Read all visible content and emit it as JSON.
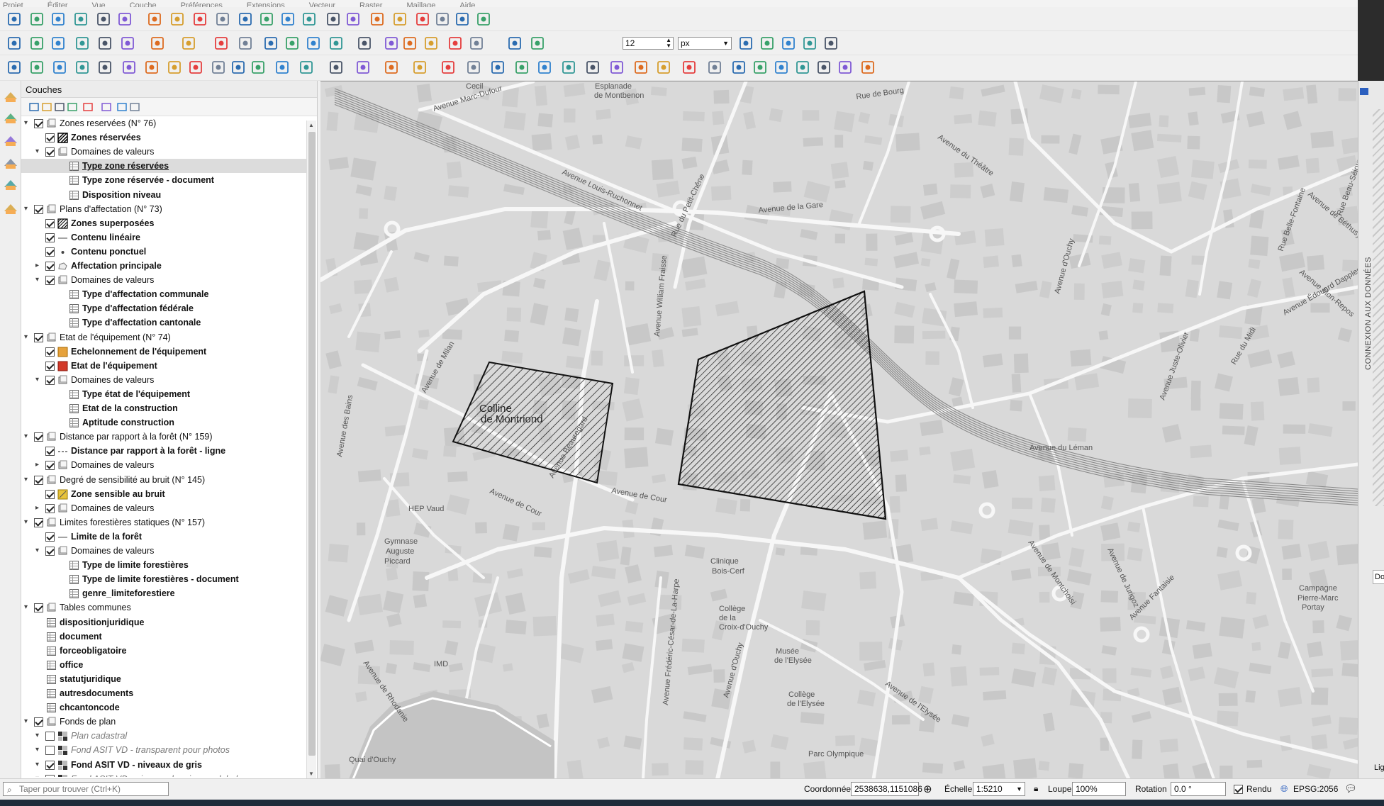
{
  "menu": [
    "Projet",
    "Éditer",
    "Vue",
    "Couche",
    "Préférences",
    "Extensions",
    "Vecteur",
    "Raster",
    "Maillage",
    "Aide"
  ],
  "toolbar": {
    "snap_tolerance": "12",
    "snap_unit": "px"
  },
  "layers_panel": {
    "title": "Couches",
    "tree": [
      {
        "label": "Zones reservées (N° 76)",
        "indent": 0,
        "arrow": "down",
        "checked": true,
        "icon": "group",
        "style": "normal"
      },
      {
        "label": "Zones réservées",
        "indent": 1,
        "arrow": "",
        "checked": true,
        "icon": "hatch",
        "style": "bold"
      },
      {
        "label": "Domaines de valeurs",
        "indent": 1,
        "arrow": "down",
        "checked": true,
        "icon": "group",
        "style": "normal"
      },
      {
        "label": "Type zone réservées",
        "indent": 2,
        "arrow": "",
        "checked": null,
        "icon": "table",
        "style": "bold-underline",
        "selected": true
      },
      {
        "label": "Type zone réservée - document",
        "indent": 2,
        "arrow": "",
        "checked": null,
        "icon": "table",
        "style": "bold"
      },
      {
        "label": "Disposition niveau",
        "indent": 2,
        "arrow": "",
        "checked": null,
        "icon": "table",
        "style": "bold"
      },
      {
        "label": "Plans d'affectation (N° 73)",
        "indent": 0,
        "arrow": "down",
        "checked": true,
        "icon": "group",
        "style": "normal"
      },
      {
        "label": "Zones superposées",
        "indent": 1,
        "arrow": "",
        "checked": true,
        "icon": "hatch2",
        "style": "bold"
      },
      {
        "label": "Contenu linéaire",
        "indent": 1,
        "arrow": "",
        "checked": true,
        "icon": "line",
        "style": "bold"
      },
      {
        "label": "Contenu ponctuel",
        "indent": 1,
        "arrow": "",
        "checked": true,
        "icon": "point",
        "style": "bold"
      },
      {
        "label": "Affectation principale",
        "indent": 1,
        "arrow": "right",
        "checked": true,
        "icon": "polygon",
        "style": "bold"
      },
      {
        "label": "Domaines de valeurs",
        "indent": 1,
        "arrow": "down",
        "checked": true,
        "icon": "group",
        "style": "normal"
      },
      {
        "label": "Type d'affectation communale",
        "indent": 2,
        "arrow": "",
        "checked": null,
        "icon": "table",
        "style": "bold"
      },
      {
        "label": "Type d'affectation fédérale",
        "indent": 2,
        "arrow": "",
        "checked": null,
        "icon": "table",
        "style": "bold"
      },
      {
        "label": "Type d'affectation cantonale",
        "indent": 2,
        "arrow": "",
        "checked": null,
        "icon": "table",
        "style": "bold"
      },
      {
        "label": "Etat de l'équipement (N° 74)",
        "indent": 0,
        "arrow": "down",
        "checked": true,
        "icon": "group",
        "style": "normal"
      },
      {
        "label": "Echelonnement de l'équipement",
        "indent": 1,
        "arrow": "",
        "checked": true,
        "icon": "fill-orange",
        "style": "bold"
      },
      {
        "label": "Etat de l'équipement",
        "indent": 1,
        "arrow": "",
        "checked": true,
        "icon": "fill-red",
        "style": "bold"
      },
      {
        "label": "Domaines de valeurs",
        "indent": 1,
        "arrow": "down",
        "checked": true,
        "icon": "group",
        "style": "normal"
      },
      {
        "label": "Type état de l'équipement",
        "indent": 2,
        "arrow": "",
        "checked": null,
        "icon": "table",
        "style": "bold"
      },
      {
        "label": "Etat de la construction",
        "indent": 2,
        "arrow": "",
        "checked": null,
        "icon": "table",
        "style": "bold"
      },
      {
        "label": "Aptitude construction",
        "indent": 2,
        "arrow": "",
        "checked": null,
        "icon": "table",
        "style": "bold"
      },
      {
        "label": "Distance par rapport à la forêt (N° 159)",
        "indent": 0,
        "arrow": "down",
        "checked": true,
        "icon": "group",
        "style": "normal"
      },
      {
        "label": "Distance par rapport à la forêt - ligne",
        "indent": 1,
        "arrow": "",
        "checked": true,
        "icon": "dashline",
        "style": "bold"
      },
      {
        "label": "Domaines de valeurs",
        "indent": 1,
        "arrow": "right",
        "checked": true,
        "icon": "group",
        "style": "normal"
      },
      {
        "label": "Degré de sensibilité au bruit (N° 145)",
        "indent": 0,
        "arrow": "down",
        "checked": true,
        "icon": "group",
        "style": "normal"
      },
      {
        "label": "Zone sensible au bruit",
        "indent": 1,
        "arrow": "",
        "checked": true,
        "icon": "fill-yellow",
        "style": "bold"
      },
      {
        "label": "Domaines de valeurs",
        "indent": 1,
        "arrow": "right",
        "checked": true,
        "icon": "group",
        "style": "normal"
      },
      {
        "label": "Limites forestières statiques (N° 157)",
        "indent": 0,
        "arrow": "down",
        "checked": true,
        "icon": "group",
        "style": "normal"
      },
      {
        "label": "Limite de la forêt",
        "indent": 1,
        "arrow": "",
        "checked": true,
        "icon": "line",
        "style": "bold"
      },
      {
        "label": "Domaines de valeurs",
        "indent": 1,
        "arrow": "down",
        "checked": true,
        "icon": "group",
        "style": "normal"
      },
      {
        "label": "Type de limite forestières",
        "indent": 2,
        "arrow": "",
        "checked": null,
        "icon": "table",
        "style": "bold"
      },
      {
        "label": "Type de limite forestières - document",
        "indent": 2,
        "arrow": "",
        "checked": null,
        "icon": "table",
        "style": "bold"
      },
      {
        "label": "genre_limiteforestiere",
        "indent": 2,
        "arrow": "",
        "checked": null,
        "icon": "table",
        "style": "bold"
      },
      {
        "label": "Tables communes",
        "indent": 0,
        "arrow": "down",
        "checked": true,
        "icon": "group",
        "style": "normal"
      },
      {
        "label": "dispositionjuridique",
        "indent": 1,
        "arrow": "",
        "checked": null,
        "icon": "table",
        "style": "bold",
        "tableflush": true
      },
      {
        "label": "document",
        "indent": 1,
        "arrow": "",
        "checked": null,
        "icon": "table",
        "style": "bold",
        "tableflush": true
      },
      {
        "label": "forceobligatoire",
        "indent": 1,
        "arrow": "",
        "checked": null,
        "icon": "table",
        "style": "bold",
        "tableflush": true
      },
      {
        "label": "office",
        "indent": 1,
        "arrow": "",
        "checked": null,
        "icon": "table",
        "style": "bold",
        "tableflush": true
      },
      {
        "label": "statutjuridique",
        "indent": 1,
        "arrow": "",
        "checked": null,
        "icon": "table",
        "style": "bold",
        "tableflush": true
      },
      {
        "label": "autresdocuments",
        "indent": 1,
        "arrow": "",
        "checked": null,
        "icon": "table",
        "style": "bold",
        "tableflush": true
      },
      {
        "label": "chcantoncode",
        "indent": 1,
        "arrow": "",
        "checked": null,
        "icon": "table",
        "style": "bold",
        "tableflush": true
      },
      {
        "label": "Fonds de plan",
        "indent": 0,
        "arrow": "down",
        "checked": true,
        "icon": "group",
        "style": "normal"
      },
      {
        "label": "Plan cadastral",
        "indent": 1,
        "arrow": "down",
        "checked": false,
        "icon": "wms",
        "style": "italic"
      },
      {
        "label": "Fond ASIT VD - transparent pour photos",
        "indent": 1,
        "arrow": "down",
        "checked": false,
        "icon": "wms",
        "style": "italic"
      },
      {
        "label": "Fond ASIT VD - niveaux de gris",
        "indent": 1,
        "arrow": "down",
        "checked": true,
        "icon": "wms",
        "style": "bold"
      },
      {
        "label": "Fond ASIT VD - niveaux de gris sans labels",
        "indent": 1,
        "arrow": "down",
        "checked": false,
        "icon": "wms",
        "style": "italic"
      }
    ]
  },
  "map": {
    "labels": [
      {
        "text": "Cecil",
        "r": 0
      },
      {
        "text": "Esplanade",
        "r": 0
      },
      {
        "text": "de Montbenon",
        "r": 0
      },
      {
        "text": "Avenue Marc-Dufour",
        "r": -17
      },
      {
        "text": "Avenue Louis-Ruchonnet",
        "r": 25
      },
      {
        "text": "Rue de Bourg",
        "r": -8
      },
      {
        "text": "Avenue du Théâtre",
        "r": 35
      },
      {
        "text": "Rue Beau-Séjour",
        "r": -70
      },
      {
        "text": "Avenue de la Gare",
        "r": -5
      },
      {
        "text": "Rue du Petit-Chêne",
        "r": -65
      },
      {
        "text": "Avenue William Fraisse",
        "r": -85
      },
      {
        "text": "Avenue de Milan",
        "r": -60
      },
      {
        "text": "Avenue d'Ouchy",
        "r": -75
      },
      {
        "text": "Avenue Juste-Olivier",
        "r": -70
      },
      {
        "text": "Avenue des Bains",
        "r": -80
      },
      {
        "text": "Avenue de Cour",
        "r": 25
      },
      {
        "text": "Avenue de Cour",
        "r": 10
      },
      {
        "text": "Avenue Beauregard",
        "r": -60
      },
      {
        "text": "HEP Vaud",
        "r": 0
      },
      {
        "text": "Gymnase",
        "r": 0
      },
      {
        "text": "Auguste",
        "r": 0
      },
      {
        "text": "Piccard",
        "r": 0
      },
      {
        "text": "Clinique",
        "r": 0
      },
      {
        "text": "Bois-Cerf",
        "r": 0
      },
      {
        "text": "Collège",
        "r": 0
      },
      {
        "text": "de la",
        "r": 0
      },
      {
        "text": "Croix-d'Ouchy",
        "r": 0
      },
      {
        "text": "Avenue de Rhodanie",
        "r": 55
      },
      {
        "text": "IMD",
        "r": 0
      },
      {
        "text": "Avenue Frédéric-César-de-La-Harpe",
        "r": -85
      },
      {
        "text": "Avenue d'Ouchy",
        "r": -75
      },
      {
        "text": "Musée",
        "r": 0
      },
      {
        "text": "de l'Elysée",
        "r": 0
      },
      {
        "text": "Collège",
        "r": 0
      },
      {
        "text": "de l'Elysée",
        "r": 0
      },
      {
        "text": "Avenue de l'Elysée",
        "r": 35
      },
      {
        "text": "Parc Olympique",
        "r": 0
      },
      {
        "text": "Avenue de Montchoisi",
        "r": 55
      },
      {
        "text": "Avenue de Jurigoz",
        "r": 65
      },
      {
        "text": "Avenue Fantaisie",
        "r": -45
      },
      {
        "text": "Campagne",
        "r": 0
      },
      {
        "text": "Pierre-Marc",
        "r": 0
      },
      {
        "text": "Portay",
        "r": 0
      },
      {
        "text": "Avenue Mon-Repos",
        "r": 40
      },
      {
        "text": "Rue Belle-Fontaine",
        "r": -70
      },
      {
        "text": "Avenue de Béthusy",
        "r": 40
      },
      {
        "text": "Colline",
        "r": 0
      },
      {
        "text": "de Montriond",
        "r": 0
      },
      {
        "text": "Avenue du Léman",
        "r": 0
      },
      {
        "text": "Rue du Midi",
        "r": -60
      },
      {
        "text": "Avenue Édouard Dapples",
        "r": -30
      },
      {
        "text": "Quai d'Ouchy",
        "r": 0
      }
    ]
  },
  "status": {
    "search_placeholder": "Taper pour trouver (Ctrl+K)",
    "coord_label": "Coordonnée",
    "coord_value": "2538638,1151086",
    "scale_label": "Échelle",
    "scale_value": "1:5210",
    "magnifier_label": "Loupe",
    "magnifier_value": "100%",
    "rotation_label": "Rotation",
    "rotation_value": "0.0 °",
    "render_label": "Rendu",
    "crs": "EPSG:2056"
  },
  "right_panel": {
    "vertical_title": "CONNEXION AUX DONNÉES",
    "frag1": "Do",
    "frag2": "Lig"
  }
}
